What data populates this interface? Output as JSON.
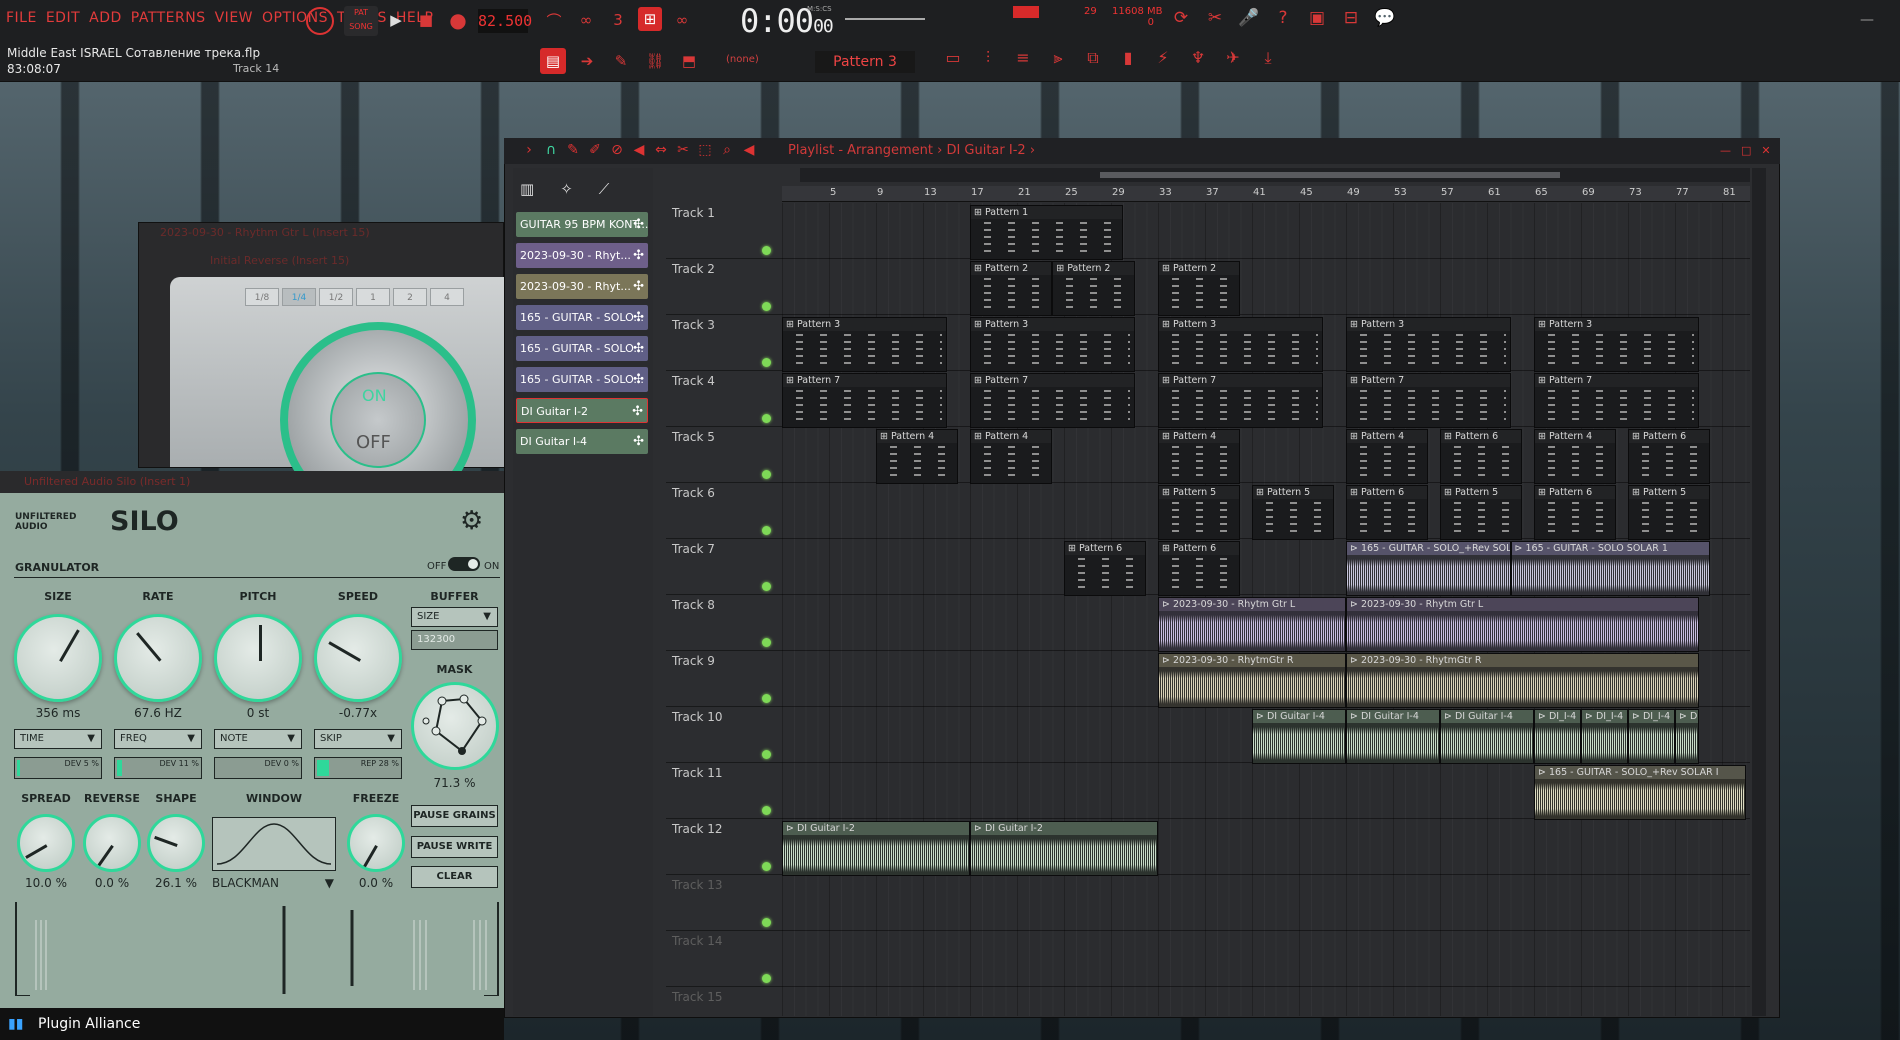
{
  "menu": [
    "FILE",
    "EDIT",
    "ADD",
    "PATTERNS",
    "VIEW",
    "OPTIONS",
    "TOOLS",
    "HELP"
  ],
  "project": {
    "title": "Middle East ISRAEL Сотавление трека.flp",
    "time": "83:08:07",
    "hint": "Track 14"
  },
  "transport": {
    "pat_label": "PAT",
    "song_label": "SONG",
    "tempo": "82.500",
    "clock": "0:00",
    "clock_sub": "00",
    "clock_label": "M:S:CS"
  },
  "perf": {
    "cpu": "29",
    "memory": "11608 MB",
    "voices": "0"
  },
  "toolbar2": {
    "none_label": "(none)",
    "pattern": "Pattern 3"
  },
  "playlist": {
    "title": "Playlist - Arrangement",
    "crumb": "DI Guitar I-2",
    "ruler": [
      "5",
      "9",
      "13",
      "17",
      "21",
      "25",
      "29",
      "33",
      "37",
      "41",
      "45",
      "49",
      "53",
      "57",
      "61",
      "65",
      "69",
      "73",
      "77",
      "81"
    ],
    "clips_panel": [
      {
        "label": "GUITAR 95 BPM KONT...",
        "color": "#5b7a62"
      },
      {
        "label": "2023-09-30 - Rhyt...",
        "color": "#6e5f8a"
      },
      {
        "label": "2023-09-30 - Rhyt...",
        "color": "#7b7659"
      },
      {
        "label": "165 - GUITAR - SOLO...",
        "color": "#605f86"
      },
      {
        "label": "165 - GUITAR - SOLO...",
        "color": "#605f86"
      },
      {
        "label": "165 - GUITAR - SOLO...",
        "color": "#605f86"
      },
      {
        "label": "DI Guitar I-2",
        "color": "#5b7a62"
      },
      {
        "label": "DI Guitar I-4",
        "color": "#5b7a62"
      }
    ],
    "tracks": [
      "Track 1",
      "Track 2",
      "Track 3",
      "Track 4",
      "Track 5",
      "Track 6",
      "Track 7",
      "Track 8",
      "Track 9",
      "Track 10",
      "Track 11",
      "Track 12",
      "Track 13",
      "Track 14",
      "Track 15"
    ]
  },
  "reverse_plugin": {
    "title": "2023-09-30 - Rhythm Gtr L (Insert 15)",
    "subtitle": "Initial Reverse (Insert 15)",
    "rates": [
      "1/8",
      "1/4",
      "1/2",
      "1",
      "2",
      "4"
    ],
    "on": "ON",
    "off": "OFF"
  },
  "silo": {
    "header": "Unfiltered Audio Silo (Insert 1)",
    "brand": "UNFILTERED AUDIO",
    "name": "SILO",
    "section": "GRANULATOR",
    "off": "OFF",
    "on": "ON",
    "size": {
      "label": "SIZE",
      "value": "356 ms",
      "mode": "TIME",
      "dev": "DEV 5 %"
    },
    "rate": {
      "label": "RATE",
      "value": "67.6 HZ",
      "mode": "FREQ",
      "dev": "DEV 11 %"
    },
    "pitch": {
      "label": "PITCH",
      "value": "0 st",
      "mode": "NOTE",
      "dev": "DEV 0 %"
    },
    "speed": {
      "label": "SPEED",
      "value": "-0.77x",
      "mode": "SKIP",
      "dev": "REP 28 %"
    },
    "buffer": {
      "label": "BUFFER",
      "mode": "SIZE",
      "value": "132300"
    },
    "mask": {
      "label": "MASK",
      "value": "71.3 %"
    },
    "spread": {
      "label": "SPREAD",
      "value": "10.0 %"
    },
    "reverse": {
      "label": "REVERSE",
      "value": "0.0 %"
    },
    "shape": {
      "label": "SHAPE",
      "value": "26.1 %"
    },
    "window": {
      "label": "WINDOW",
      "value": "BLACKMAN"
    },
    "freeze": {
      "label": "FREEZE",
      "value": "0.0 %"
    },
    "buttons": [
      "PAUSE GRAINS",
      "PAUSE WRITE",
      "CLEAR"
    ],
    "footer": "Plugin Alliance"
  }
}
